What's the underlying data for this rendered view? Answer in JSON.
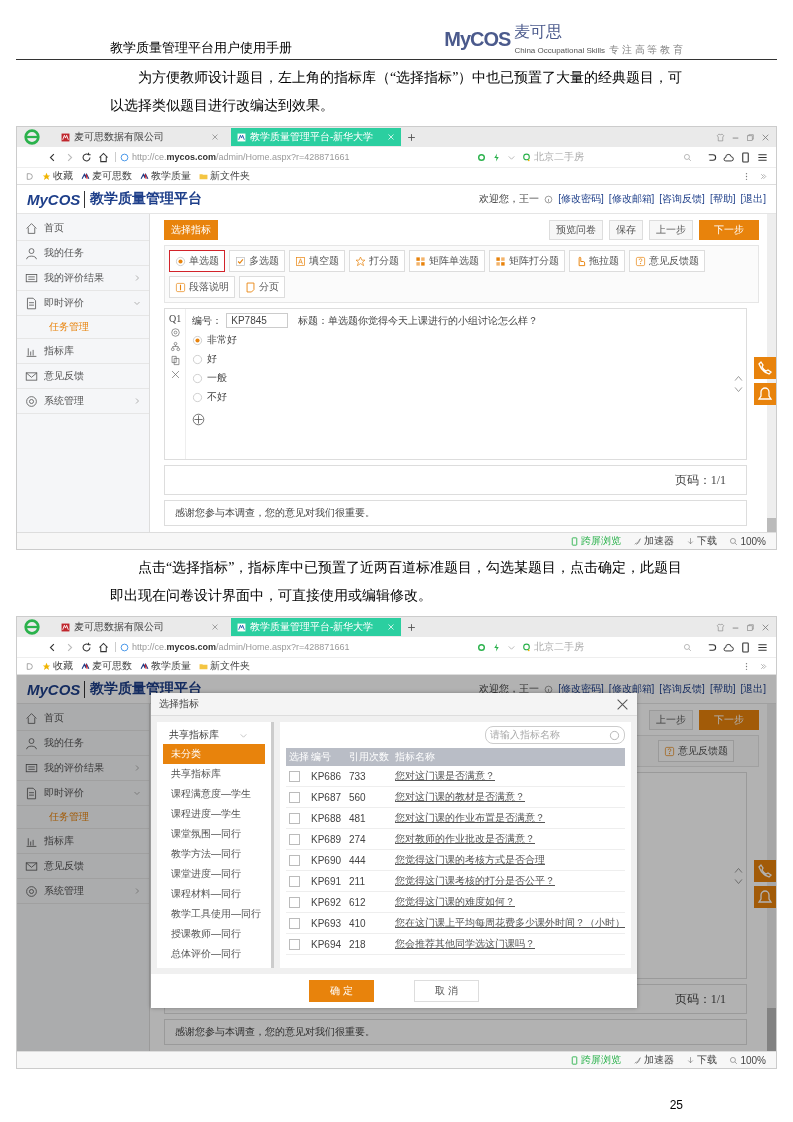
{
  "header": {
    "title": "教学质量管理平台用户使用手册",
    "logo_mark": "MyCOS",
    "logo_text": "麦可思",
    "logo_tagline": "China Occupational Skills",
    "logo_slogan": "专 注 高 等 教 育"
  },
  "content": [
    {
      "kind": "paragraph",
      "text": "为方便教师设计题目，左上角的指标库（“选择指标”）中也已预置了大量的经典题目，可以选择类似题目进行改编达到效果。"
    },
    {
      "kind": "screenshot",
      "browser": {
        "tabs": [
          {
            "label": "麦可思数据有限公司",
            "selected": false
          },
          {
            "label": "教学质量管理平台-新华大学",
            "selected": true
          }
        ],
        "address": "http://ce.**mycos.com**/admin/Home.aspx?r=428871661",
        "search_placeholder": "北京二手房",
        "bookmarks": [
          "收藏",
          "麦可思数",
          "教学质量",
          "新文件夹"
        ],
        "status": [
          "跨屏浏览",
          "加速器",
          "下载",
          "100%"
        ]
      },
      "app": {
        "logo_mark": "MyCOS",
        "title": "教学质量管理平台",
        "welcome": "欢迎您，王一",
        "links": [
          "[修改密码]",
          "[修改邮箱]",
          "[咨询反馈]",
          "[帮助]",
          "[退出]"
        ],
        "nav": [
          {
            "label": "首页",
            "selected": false
          },
          {
            "label": "我的任务",
            "selected": false
          },
          {
            "label": "我的评价结果",
            "selected": false,
            "expanded": false
          },
          {
            "label": "即时评价",
            "selected": false,
            "expanded": true,
            "children": [
              {
                "label": "任务管理",
                "selected": true
              }
            ]
          },
          {
            "label": "指标库",
            "selected": false
          },
          {
            "label": "意见反馈",
            "selected": false
          },
          {
            "label": "系统管理",
            "selected": false,
            "expanded": false
          }
        ],
        "pick_button": "选择指标",
        "actions": [
          {
            "label": "预览问卷",
            "primary": false
          },
          {
            "label": "保存",
            "primary": false
          },
          {
            "label": "上一步",
            "primary": false
          },
          {
            "label": "下一步",
            "primary": true
          }
        ],
        "type_rows": [
          [
            {
              "label": "单选题",
              "kind": "single",
              "selected": true
            },
            {
              "label": "多选题",
              "kind": "multi",
              "selected": false
            },
            {
              "label": "填空题",
              "kind": "fill",
              "selected": false
            },
            {
              "label": "打分题",
              "kind": "rating",
              "selected": false
            },
            {
              "label": "矩阵单选题",
              "kind": "matrix",
              "selected": false
            },
            {
              "label": "矩阵打分题",
              "kind": "matrix",
              "selected": false
            },
            {
              "label": "拖拉题",
              "kind": "drag",
              "selected": false
            },
            {
              "label": "意见反馈题",
              "kind": "feedback",
              "selected": false
            }
          ],
          [
            {
              "label": "段落说明",
              "kind": "paragraph",
              "selected": false
            },
            {
              "label": "分页",
              "kind": "page",
              "selected": false
            }
          ]
        ],
        "question": {
          "number": "Q1",
          "code_label": "编号：",
          "code": "KP7845",
          "title": "标题：单选题你觉得今天上课进行的小组讨论怎么样？",
          "options": [
            {
              "label": "非常好",
              "selected": true
            },
            {
              "label": "好",
              "selected": false
            },
            {
              "label": "一般",
              "selected": false
            },
            {
              "label": "不好",
              "selected": false
            }
          ]
        },
        "page_label": "页码：1/1",
        "thanks": "感谢您参与本调查，您的意见对我们很重要。"
      }
    },
    {
      "kind": "paragraph",
      "text": "点击“选择指标”，指标库中已预置了近两百道标准题目，勾选某题目，点击确定，此题目即出现在问卷设计界面中，可直接使用或编辑修改。"
    },
    {
      "kind": "screenshot",
      "browser": {
        "tabs": [
          {
            "label": "麦可思数据有限公司",
            "selected": false
          },
          {
            "label": "教学质量管理平台-新华大学",
            "selected": true
          }
        ],
        "address": "http://ce.**mycos.com**/admin/Home.aspx?r=428871661",
        "search_placeholder": "北京二手房",
        "bookmarks": [
          "收藏",
          "麦可思数",
          "教学质量",
          "新文件夹"
        ],
        "status": [
          "跨屏浏览",
          "加速器",
          "下载",
          "100%"
        ]
      },
      "app": {
        "logo_mark": "MyCOS",
        "title": "教学质量管理平台",
        "welcome": "欢迎您，王一",
        "links": [
          "[修改密码]",
          "[修改邮箱]",
          "[咨询反馈]",
          "[帮助]",
          "[退出]"
        ],
        "nav": [
          {
            "label": "首页",
            "selected": false
          },
          {
            "label": "我的任务",
            "selected": false
          },
          {
            "label": "我的评价结果",
            "selected": false,
            "expanded": false
          },
          {
            "label": "即时评价",
            "selected": false,
            "expanded": true,
            "children": [
              {
                "label": "任务管理",
                "selected": true
              }
            ]
          },
          {
            "label": "指标库",
            "selected": false
          },
          {
            "label": "意见反馈",
            "selected": false
          },
          {
            "label": "系统管理",
            "selected": false,
            "expanded": false
          }
        ],
        "actions": [
          {
            "label": "上一步",
            "primary": false
          },
          {
            "label": "下一步",
            "primary": true
          }
        ],
        "type_rows": [
          [
            {
              "label": "意见反馈题",
              "kind": "feedback",
              "selected": false
            }
          ]
        ],
        "page_label": "页码：1/1",
        "thanks": "感谢您参与本调查，您的意见对我们很重要。",
        "dialog": {
          "title": "选择指标",
          "tree": {
            "label": "共享指标库",
            "expanded": true,
            "children": [
              {
                "label": "未分类",
                "selected": true
              },
              {
                "label": "共享指标库",
                "selected": false
              },
              {
                "label": "课程满意度—学生",
                "selected": false
              },
              {
                "label": "课程进度—学生",
                "selected": false
              },
              {
                "label": "课堂氛围—同行",
                "selected": false
              },
              {
                "label": "教学方法—同行",
                "selected": false
              },
              {
                "label": "课堂进度—同行",
                "selected": false
              },
              {
                "label": "课程材料—同行",
                "selected": false
              },
              {
                "label": "教学工具使用—同行",
                "selected": false
              },
              {
                "label": "授课教师—同行",
                "selected": false
              },
              {
                "label": "总体评价—同行",
                "selected": false
              }
            ]
          },
          "search_placeholder": "请输入指标名称",
          "columns": [
            "选择",
            "编号",
            "引用次数",
            "指标名称"
          ],
          "rows": [
            {
              "checked": false,
              "code": "KP686",
              "count": "733",
              "name": "您对这门课是否满意？"
            },
            {
              "checked": false,
              "code": "KP687",
              "count": "560",
              "name": "您对这门课的教材是否满意？"
            },
            {
              "checked": false,
              "code": "KP688",
              "count": "481",
              "name": "您对这门课的作业布置是否满意？"
            },
            {
              "checked": false,
              "code": "KP689",
              "count": "274",
              "name": "您对教师的作业批改是否满意？"
            },
            {
              "checked": false,
              "code": "KP690",
              "count": "444",
              "name": "您觉得这门课的考核方式是否合理"
            },
            {
              "checked": false,
              "code": "KP691",
              "count": "211",
              "name": "您觉得这门课考核的打分是否公平？"
            },
            {
              "checked": false,
              "code": "KP692",
              "count": "612",
              "name": "您觉得这门课的难度如何？"
            },
            {
              "checked": false,
              "code": "KP693",
              "count": "410",
              "name": "您在这门课上平均每周花费多少课外时间？（小时）"
            },
            {
              "checked": false,
              "code": "KP694",
              "count": "218",
              "name": "您会推荐其他同学选这门课吗？"
            }
          ],
          "buttons": [
            {
              "label": "确 定",
              "primary": true
            },
            {
              "label": "取 消",
              "primary": false
            }
          ]
        }
      }
    }
  ],
  "page_number": "25"
}
